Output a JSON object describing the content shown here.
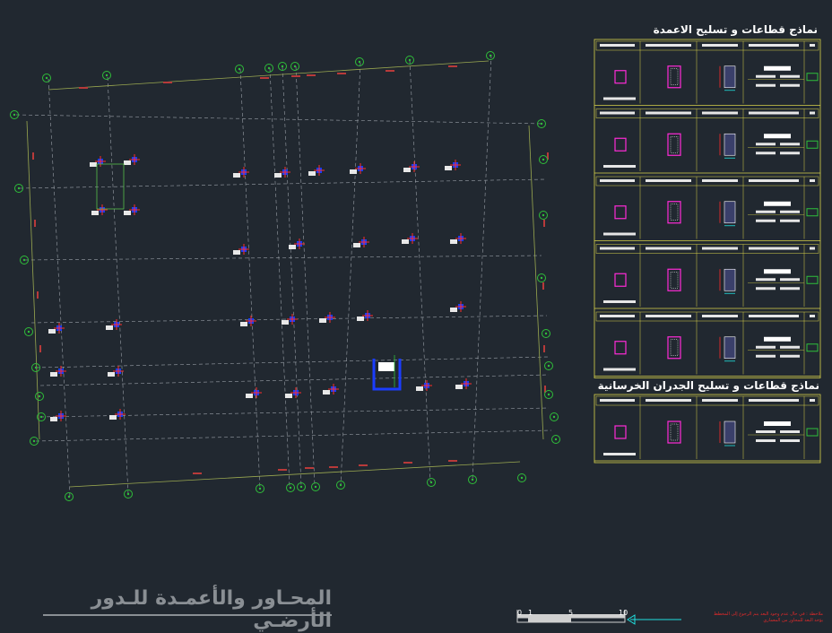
{
  "drawing": {
    "title": "المحـاور والأعمـدة للـدور الأرضـي",
    "columns_table_title": "نماذج قطاعات و تسليح الاعمدة",
    "walls_table_title": "نماذج قطاعات و تسليح الجدران الخرسانية",
    "note_line1": "ملاحظة : في حال عدم وجود البعد يتم الرجوع إلى المخطط",
    "note_line2": "يؤخذ البعد للمحاور من المعماري"
  },
  "scale_bar": {
    "labels": [
      "0",
      "1",
      "5",
      "10"
    ]
  },
  "column_tags": [
    "ع١",
    "ع٢",
    "ع٣",
    "ع٤",
    "ج١"
  ],
  "table_headers": [
    "الرمز",
    "القطاع و التسليح",
    "القطاع الخرساني",
    "توزيع أسياخ التسليح",
    "تفاصيل الكانات"
  ],
  "column_rows": [
    {
      "tag": "ع٥",
      "size": "٢٥×١٥سم",
      "bars": "٤ ط ١٢",
      "stirrups": "٨ ط ٨/م",
      "note": "جميع الكانات ١"
    },
    {
      "tag": "ع١",
      "size": "١٥ × ٥٠سم",
      "bars": "٨ ط ١٢",
      "stirrups": "٨ ط ٨/م",
      "note": "جميع الكانات ٢"
    },
    {
      "tag": "ع٢",
      "size": "٢٠ × ٦٠سم",
      "bars": "٦ ط ١٦",
      "stirrups": "٨ ط ٨/م",
      "note": "جميع الكانات ٢"
    },
    {
      "tag": "ع٣",
      "size": "٣٠ × ٣٠سم",
      "bars": "٨ ط ١٦",
      "stirrups": "٨ ط ٨/م",
      "note": "جميع الكانات ٣"
    },
    {
      "tag": "ع٤",
      "size": "٢٠ × ٤٠سم",
      "bars": "٤ ط ١٦",
      "stirrups": "٨ ط ٨/م",
      "note": "جميع الكانات ٢"
    }
  ],
  "wall_rows": [
    {
      "tag": "ج١",
      "size": "٢٠×١٥سم",
      "bars": "٨ ط ١٢",
      "stirrups": "٨ ط ٨/م",
      "note": "جميع الكانات ٥"
    }
  ]
}
